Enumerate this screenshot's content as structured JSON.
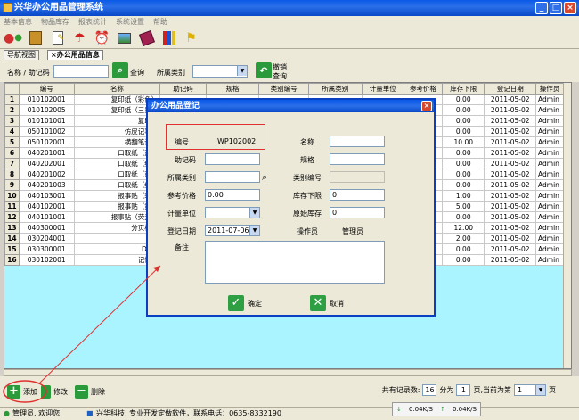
{
  "window": {
    "title": "兴华办公用品管理系统",
    "min": "_",
    "max": "□",
    "close": "×"
  },
  "menu": [
    "基本信息",
    "物品库存",
    "报表统计",
    "系统设置",
    "帮助"
  ],
  "tabs": [
    {
      "label": "导航视图"
    },
    {
      "label": "×办公用品信息"
    }
  ],
  "filter": {
    "name_label": "名称 / 助记码",
    "search_label": "查询",
    "category_label": "所属类别",
    "reset_label_1": "撤销",
    "reset_label_2": "查询"
  },
  "grid": {
    "columns": [
      "编号",
      "名称",
      "助记码",
      "规格",
      "类别编号",
      "所属类别",
      "计量单位",
      "参考价格",
      "库存下限",
      "登记日期",
      "操作员"
    ],
    "rows": [
      {
        "n": "1",
        "code": "010102001",
        "name": "复印纸（彩色）",
        "min": "0.00",
        "date": "2011-05-02",
        "op": "Admin"
      },
      {
        "n": "2",
        "code": "010102005",
        "name": "复印纸（三星）",
        "min": "0.00",
        "date": "2011-05-02",
        "op": "Admin"
      },
      {
        "n": "3",
        "code": "010101001",
        "name": "复印纸",
        "min": "0.00",
        "date": "2011-05-02",
        "op": "Admin"
      },
      {
        "n": "4",
        "code": "050101002",
        "name": "仿皮记事本",
        "min": "0.00",
        "date": "2011-05-02",
        "op": "Admin"
      },
      {
        "n": "5",
        "code": "050102001",
        "name": "横翻笔记本",
        "min": "10.00",
        "date": "2011-05-02",
        "op": "Admin"
      },
      {
        "n": "6",
        "code": "040201001",
        "name": "口取纸（蓝）",
        "min": "0.00",
        "date": "2011-05-02",
        "op": "Admin"
      },
      {
        "n": "7",
        "code": "040202001",
        "name": "口取纸（红）",
        "min": "0.00",
        "date": "2011-05-02",
        "op": "Admin"
      },
      {
        "n": "8",
        "code": "040201002",
        "name": "口取纸（蓝）",
        "min": "0.00",
        "date": "2011-05-02",
        "op": "Admin"
      },
      {
        "n": "9",
        "code": "040201003",
        "name": "口取纸（红）",
        "min": "0.00",
        "date": "2011-05-02",
        "op": "Admin"
      },
      {
        "n": "10",
        "code": "040103001",
        "name": "报事贴（彩）",
        "min": "1.00",
        "date": "2011-05-02",
        "op": "Admin"
      },
      {
        "n": "11",
        "code": "040102001",
        "name": "报事贴（黄）",
        "min": "5.00",
        "date": "2011-05-02",
        "op": "Admin"
      },
      {
        "n": "12",
        "code": "040101001",
        "name": "报事贴（荧光）",
        "min": "0.00",
        "date": "2011-05-02",
        "op": "Admin"
      },
      {
        "n": "13",
        "code": "040300001",
        "name": "分页标签",
        "min": "12.00",
        "date": "2011-05-02",
        "op": "Admin"
      },
      {
        "n": "14",
        "code": "030204001",
        "name": "U盘",
        "min": "2.00",
        "date": "2011-05-02",
        "op": "Admin"
      },
      {
        "n": "15",
        "code": "030300001",
        "name": "DV带",
        "min": "0.00",
        "date": "2011-05-02",
        "op": "Admin"
      },
      {
        "n": "16",
        "code": "030102001",
        "name": "记忆棒",
        "min": "0.00",
        "date": "2011-05-02",
        "op": "Admin"
      }
    ]
  },
  "actions": {
    "add": "添加",
    "edit": "修改",
    "delete": "删除"
  },
  "pager": {
    "total_label": "共有记录数:",
    "total": "16",
    "split_label": "分为",
    "pages": "1",
    "page_label": "页,当前为第",
    "current": "1",
    "page_suffix": "页"
  },
  "status": {
    "user": "管理员, 欢迎您",
    "company": "兴华科技, 专业开发定做软件，联系电话：0635-8332190"
  },
  "net": {
    "down": "0.04K/S",
    "up": "0.04K/S"
  },
  "dialog": {
    "title": "办公用品登记",
    "close": "×",
    "labels": {
      "code": "编号",
      "name": "名称",
      "mnemonic": "助记码",
      "spec": "规格",
      "category": "所属类别",
      "category_code": "类别编号",
      "price": "参考价格",
      "stock_min": "库存下限",
      "unit": "计量单位",
      "stock_init": "原始库存",
      "date": "登记日期",
      "operator": "操作员",
      "remark": "备注"
    },
    "values": {
      "code": "WP102002",
      "price": "0.00",
      "stock_min": "0",
      "stock_init": "0",
      "date": "2011-07-06",
      "operator": "管理员"
    },
    "ok": "确定",
    "cancel": "取消"
  },
  "colors": {
    "title_blue": "#0a5ae8",
    "grid_bg": "#aaf4ff",
    "ok_green": "#2ea043",
    "annotation_red": "#e03030"
  }
}
